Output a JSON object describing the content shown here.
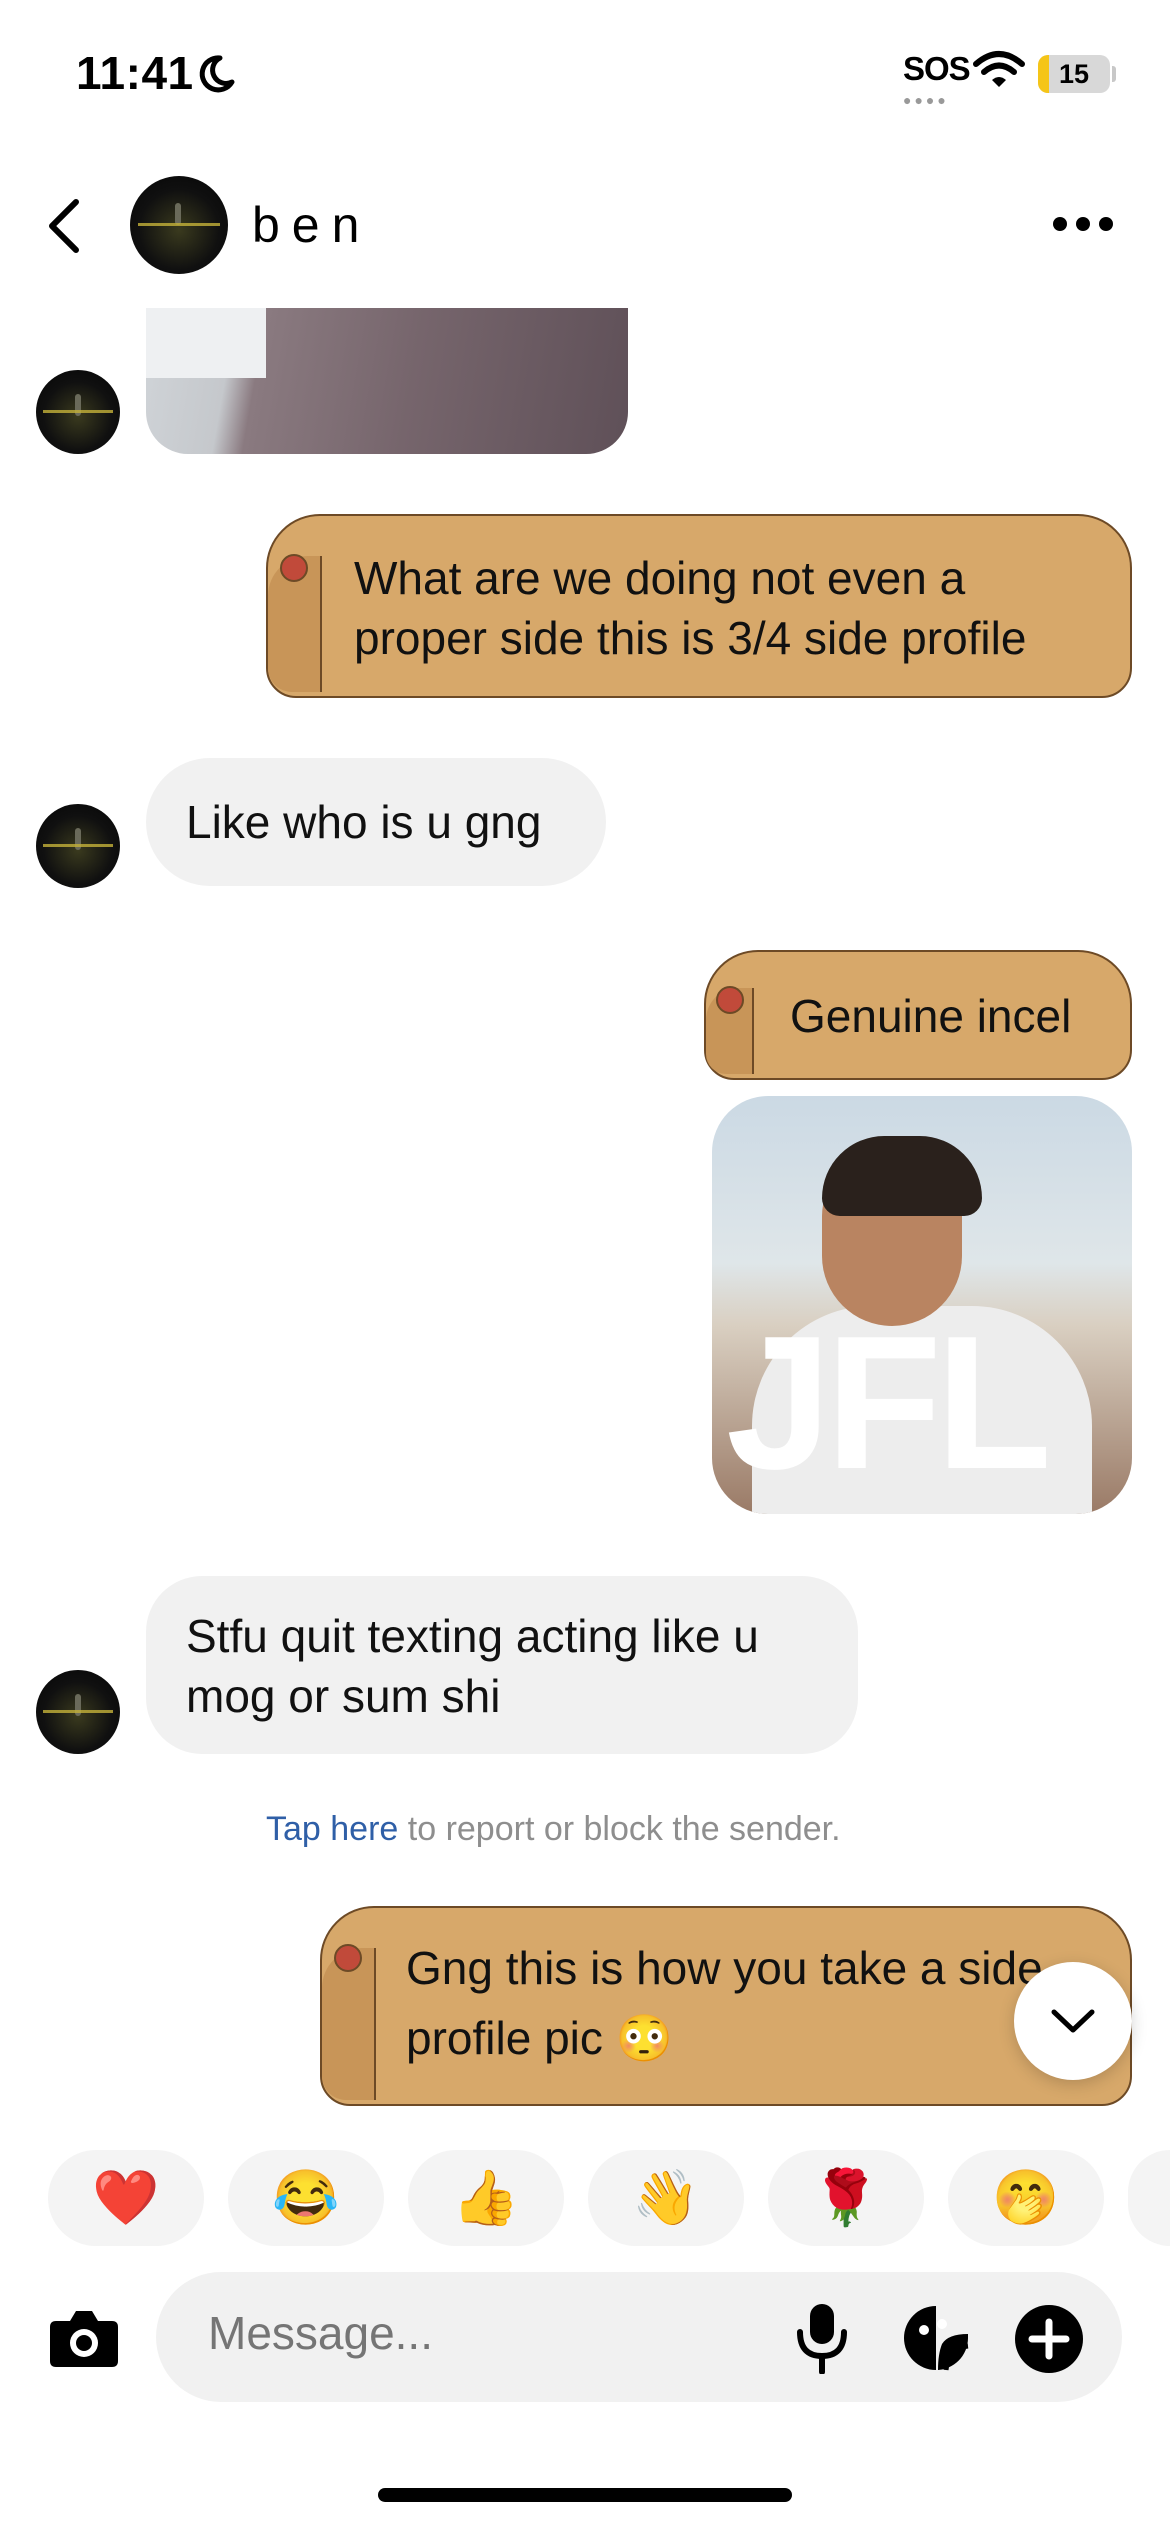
{
  "status_bar": {
    "time": "11:41",
    "sos": "SOS",
    "battery": "15",
    "battery_level_percent": 15
  },
  "header": {
    "contact_name": "ben",
    "back_icon": "chevron-left-icon",
    "more_icon": "more-horizontal-icon"
  },
  "messages": [
    {
      "id": "m1",
      "side": "left",
      "kind": "image-cropped"
    },
    {
      "id": "m2",
      "side": "right",
      "kind": "text",
      "style": "capybara",
      "lines": [
        "What are we doing not even a",
        "proper side this is 3/4 side profile"
      ]
    },
    {
      "id": "m3",
      "side": "left",
      "kind": "text",
      "lines": [
        "Like who is u gng"
      ]
    },
    {
      "id": "m4",
      "side": "right",
      "kind": "text",
      "style": "capybara",
      "lines": [
        "Genuine incel"
      ]
    },
    {
      "id": "m5",
      "side": "right",
      "kind": "image",
      "overlay_text": "JFL"
    },
    {
      "id": "m6",
      "side": "left",
      "kind": "text",
      "lines": [
        "Stfu quit texting acting like u",
        "mog or sum shi"
      ]
    },
    {
      "id": "m7",
      "side": "right",
      "kind": "text",
      "style": "capybara",
      "lines": [
        "Gng this is how you take a side",
        "profile pic 😳"
      ]
    }
  ],
  "report_notice": {
    "link": "Tap here",
    "text": " to report or block the sender."
  },
  "quick_reactions": [
    "❤️",
    "😂",
    "👍",
    "👋",
    "🌹",
    "🤭"
  ],
  "composer": {
    "placeholder": "Message..."
  },
  "colors": {
    "capybara_bubble": "#d7a86a",
    "incoming_bubble": "#f1f1f1",
    "link": "#2f5fa7",
    "battery": "#f5c518"
  }
}
